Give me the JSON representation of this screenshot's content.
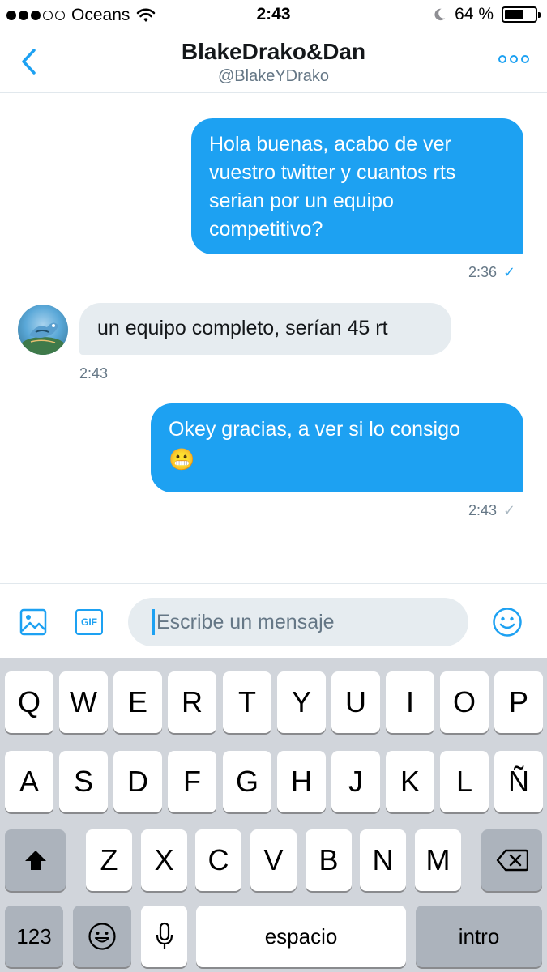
{
  "status_bar": {
    "carrier": "Oceans",
    "time": "2:43",
    "battery": "64 %",
    "battery_level": 0.64,
    "signal_bars_filled": 3,
    "signal_bars_total": 5,
    "icons": [
      "wifi-icon",
      "moon-icon",
      "battery-icon"
    ]
  },
  "header": {
    "title": "BlakeDrako&Dan",
    "handle": "@BlakeYDrako",
    "icons": [
      "back-chevron-icon",
      "more-options-icon"
    ]
  },
  "messages": [
    {
      "direction": "sent",
      "lines": [
        "Hola buenas, acabo de ver",
        "vuestro twitter y cuantos rts",
        "serian por un equipo",
        "competitivo?"
      ],
      "time": "2:36",
      "read": true
    },
    {
      "direction": "received",
      "lines": [
        "un equipo completo, serían 45 rt"
      ],
      "time": "2:43"
    },
    {
      "direction": "sent",
      "lines": [
        "Okey gracias, a ver si lo consigo",
        "😬"
      ],
      "time": "2:43",
      "read": false
    }
  ],
  "compose": {
    "placeholder": "Escribe un mensaje",
    "gif_label": "GIF",
    "icons": [
      "image-icon",
      "gif-icon",
      "emoji-icon"
    ]
  },
  "keyboard": {
    "row1": [
      "Q",
      "W",
      "E",
      "R",
      "T",
      "Y",
      "U",
      "I",
      "O",
      "P"
    ],
    "row2": [
      "A",
      "S",
      "D",
      "F",
      "G",
      "H",
      "J",
      "K",
      "L",
      "Ñ"
    ],
    "row3": [
      "Z",
      "X",
      "C",
      "V",
      "B",
      "N",
      "M"
    ],
    "numbers_label": "123",
    "space_label": "espacio",
    "return_label": "intro",
    "icons": [
      "shift-icon",
      "backspace-icon",
      "emoji-keyboard-icon",
      "microphone-icon"
    ]
  },
  "colors": {
    "accent": "#1da1f2",
    "received_bubble": "#e6ecf0",
    "keyboard_bg": "#d1d5db"
  }
}
